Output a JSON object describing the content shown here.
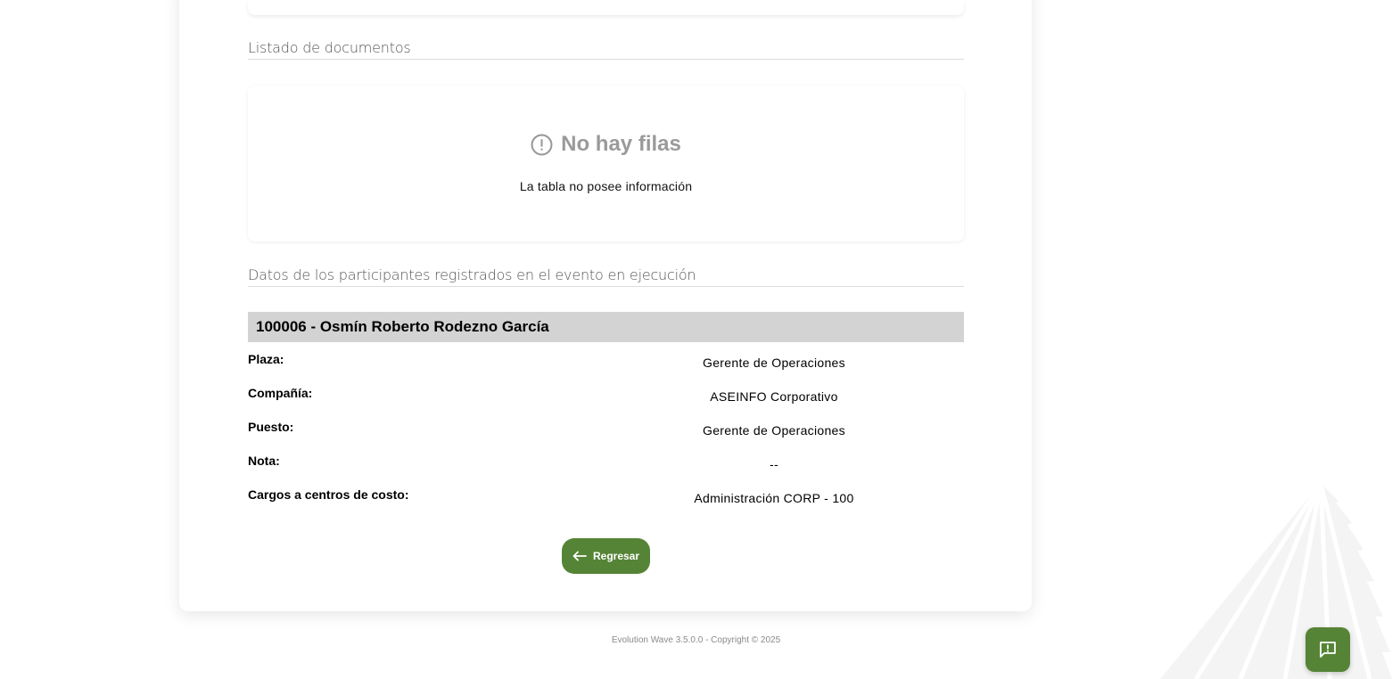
{
  "sections": {
    "documents_title": "Listado de documentos",
    "participants_title": "Datos de los participantes registrados en el evento en ejecución"
  },
  "empty_state": {
    "title": "No hay filas",
    "message": "La tabla no posee información",
    "icon": "alert-circle-icon"
  },
  "participant": {
    "header": "100006 - Osmín Roberto Rodezno García",
    "fields": [
      {
        "label": "Plaza:",
        "value": "Gerente de Operaciones"
      },
      {
        "label": "Compañía:",
        "value": "ASEINFO Corporativo"
      },
      {
        "label": "Puesto:",
        "value": "Gerente de Operaciones"
      },
      {
        "label": "Nota:",
        "value": "--"
      },
      {
        "label": "Cargos a centros de costo:",
        "value": "Administración CORP - 100"
      }
    ]
  },
  "actions": {
    "back_label": "Regresar",
    "back_icon": "arrow-left-icon"
  },
  "footer": {
    "text": "Evolution Wave 3.5.0.0 - Copyright © 2025"
  },
  "feedback": {
    "icon": "feedback-icon"
  },
  "colors": {
    "primary": "#568437",
    "header_bg": "#d3d3d3",
    "muted_text": "#9a9a9a"
  }
}
